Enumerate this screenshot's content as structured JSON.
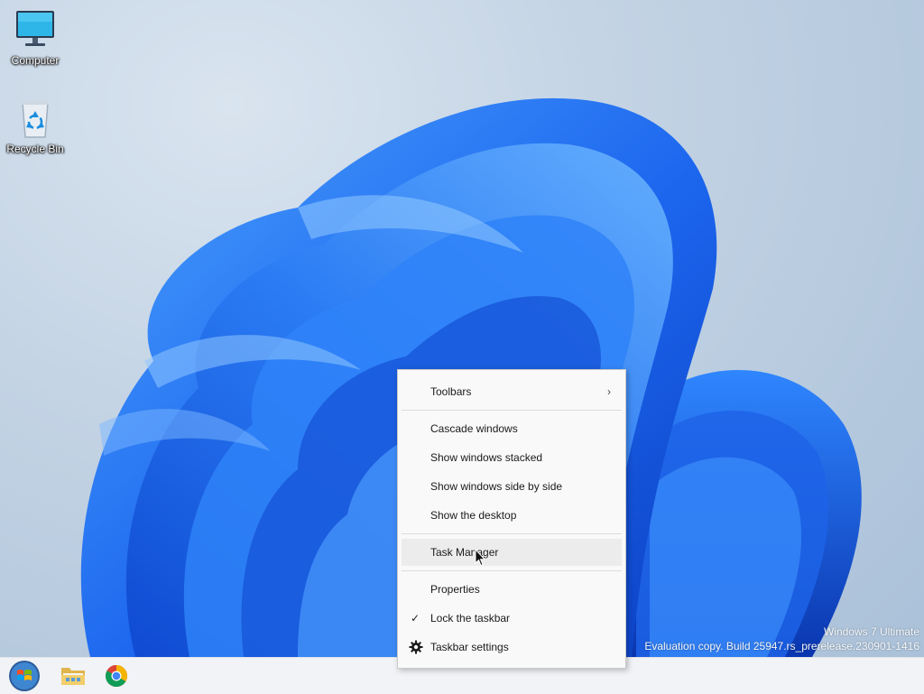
{
  "desktop": {
    "icons": [
      {
        "label": "Computer",
        "icon": "computer-icon"
      },
      {
        "label": "Recycle Bin",
        "icon": "recycle-bin-icon"
      }
    ]
  },
  "context_menu": {
    "items": [
      {
        "label": "Toolbars",
        "submenu": true
      },
      {
        "label": "Cascade windows"
      },
      {
        "label": "Show windows stacked"
      },
      {
        "label": "Show windows side by side"
      },
      {
        "label": "Show the desktop"
      },
      {
        "label": "Task Manager",
        "hovered": true
      },
      {
        "label": "Properties"
      },
      {
        "label": "Lock the taskbar",
        "checked": true
      },
      {
        "label": "Taskbar settings",
        "icon": "gear-icon"
      }
    ]
  },
  "watermark": {
    "line1": "Windows 7 Ultimate",
    "line2": "Evaluation copy. Build 25947.rs_prerelease.230901-1416"
  },
  "taskbar": {
    "buttons": [
      {
        "name": "start-button",
        "icon": "windows-orb-icon"
      },
      {
        "name": "file-explorer-button",
        "icon": "folder-icon"
      },
      {
        "name": "chrome-button",
        "icon": "chrome-icon"
      }
    ]
  },
  "colors": {
    "bloom_dark": "#0a3fc0",
    "bloom_mid": "#1e6ef0",
    "bloom_light": "#4a9bff",
    "menu_bg": "#f9f9f9",
    "taskbar_bg": "#f1f3f6"
  }
}
